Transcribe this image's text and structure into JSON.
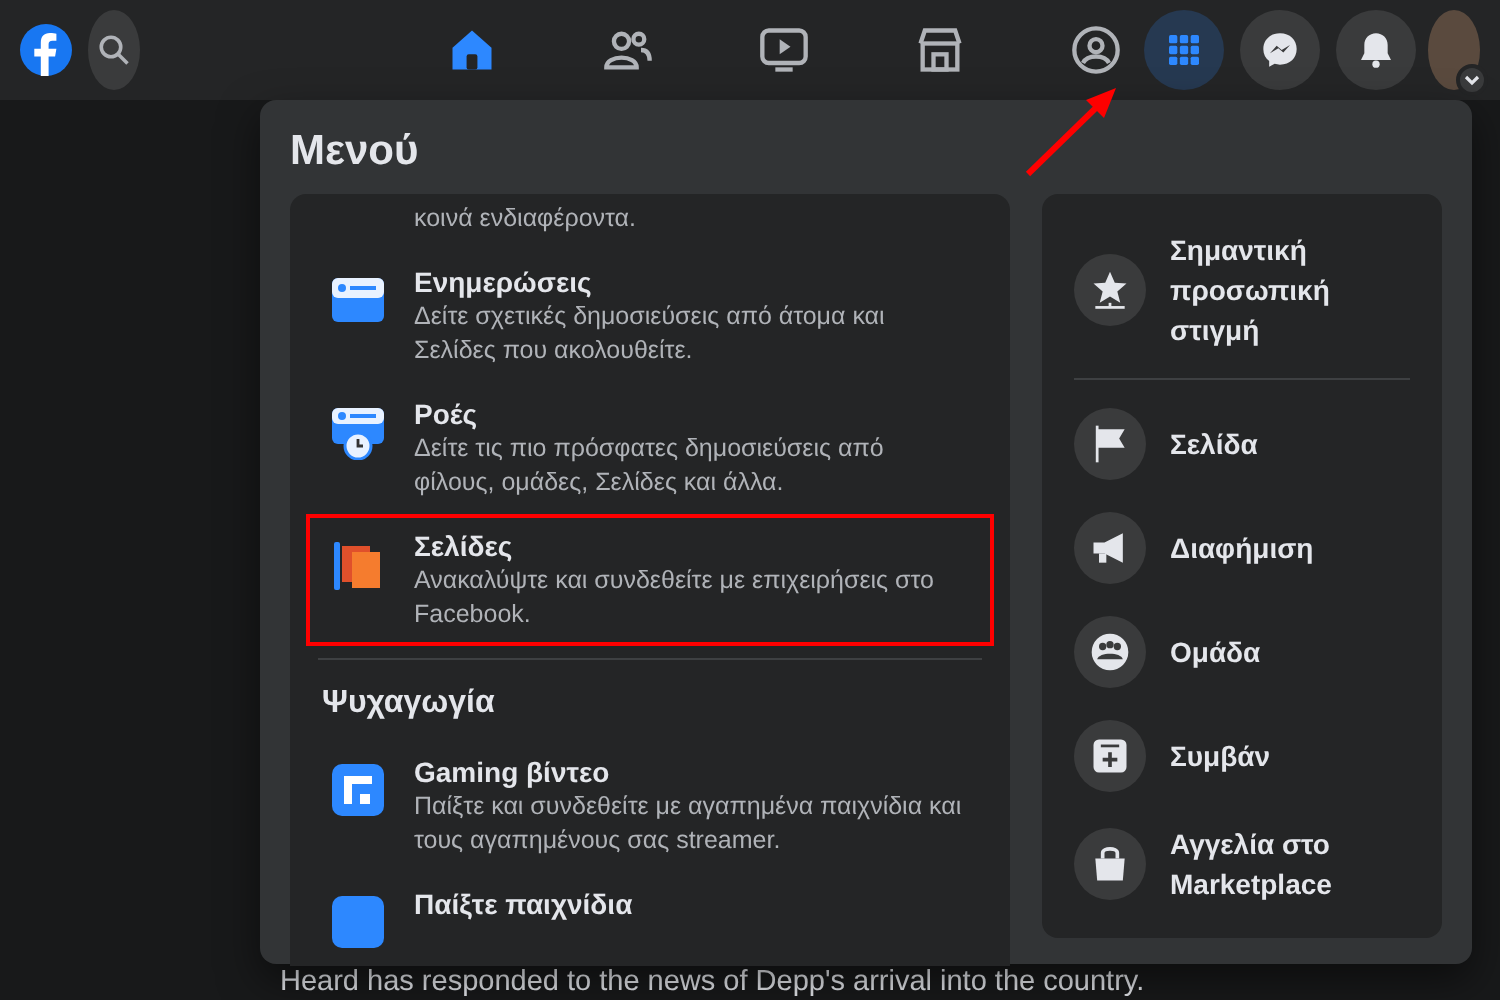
{
  "topbar": {
    "tabs": [
      {
        "selected": true
      },
      {
        "selected": false
      },
      {
        "selected": false
      },
      {
        "selected": false
      },
      {
        "selected": false
      }
    ],
    "actions": [
      {
        "selected": true
      },
      {
        "selected": false
      },
      {
        "selected": false
      }
    ]
  },
  "menu": {
    "title": "Μενού",
    "left": [
      {
        "kind": "item",
        "description": "κοινά ενδιαφέροντα.",
        "highlighted": false
      },
      {
        "kind": "item",
        "title": "Ενημερώσεις",
        "description": "Δείτε σχετικές δημοσιεύσεις από άτομα και Σελίδες που ακολουθείτε.",
        "highlighted": false
      },
      {
        "kind": "item",
        "title": "Ροές",
        "description": "Δείτε τις πιο πρόσφατες δημοσιεύσεις από φίλους, ομάδες, Σελίδες και άλλα.",
        "highlighted": false
      },
      {
        "kind": "item",
        "title": "Σελίδες",
        "description": "Ανακαλύψτε και συνδεθείτε με επιχειρήσεις στο Facebook.",
        "highlighted": true
      },
      {
        "kind": "divider"
      },
      {
        "kind": "heading",
        "title": "Ψυχαγωγία"
      },
      {
        "kind": "item",
        "title": "Gaming βίντεο",
        "description": "Παίξτε και συνδεθείτε με αγαπημένα παιχνίδια και τους αγαπημένους σας streamer.",
        "highlighted": false
      },
      {
        "kind": "item",
        "title": "Παίξτε παιχνίδια",
        "highlighted": false
      }
    ],
    "right": [
      {
        "kind": "item",
        "label": "Σημαντική προσωπική στιγμή"
      },
      {
        "kind": "divider"
      },
      {
        "kind": "item",
        "label": "Σελίδα"
      },
      {
        "kind": "item",
        "label": "Διαφήμιση"
      },
      {
        "kind": "item",
        "label": "Ομάδα"
      },
      {
        "kind": "item",
        "label": "Συμβάν"
      },
      {
        "kind": "item",
        "label": "Αγγελία στο Marketplace"
      }
    ]
  },
  "feed_text": "Heard has responded to the news of Depp's arrival into the country."
}
